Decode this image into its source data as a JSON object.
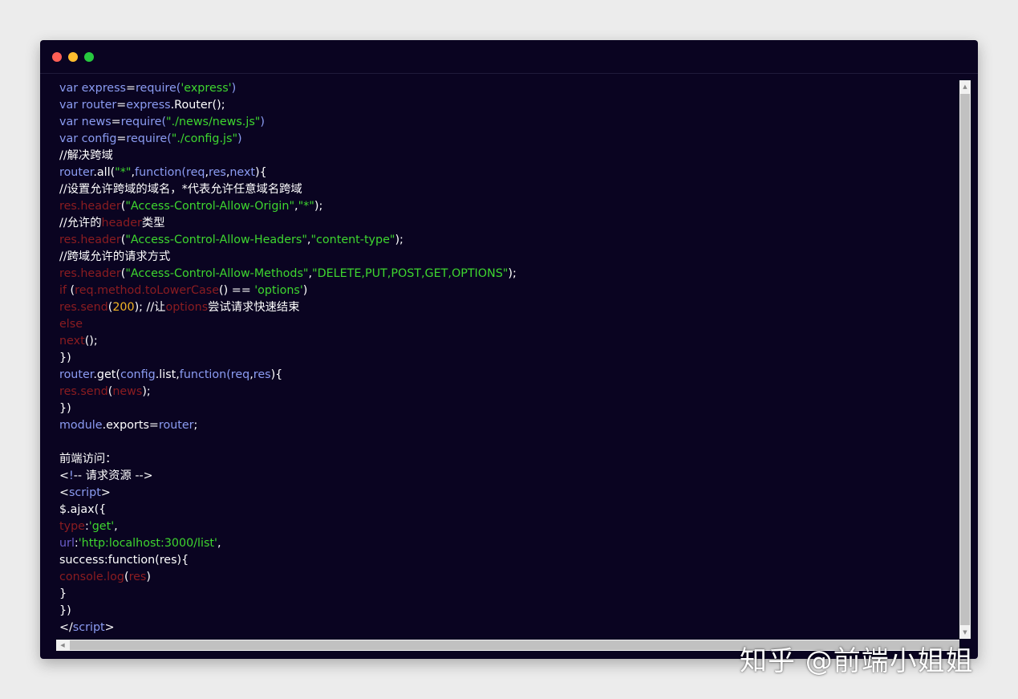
{
  "window": {
    "controls": {
      "close_color": "#ff5f56",
      "minimize_color": "#ffbd2e",
      "maximize_color": "#27c93f"
    },
    "colors": {
      "background": "#0a0421",
      "plain": "#ffffff",
      "keyword": "#8b9cf2",
      "string": "#3ed62f",
      "dark_red": "#8a1c21",
      "number": "#f1b325",
      "purple": "#6a5cc9"
    }
  },
  "code_lines": [
    [
      [
        "b",
        "var express"
      ],
      [
        "w",
        "="
      ],
      [
        "b",
        "require("
      ],
      [
        "g",
        "'express'"
      ],
      [
        "b",
        ")"
      ]
    ],
    [
      [
        "b",
        "var router"
      ],
      [
        "w",
        "="
      ],
      [
        "b",
        "express"
      ],
      [
        "w",
        ".Router();"
      ]
    ],
    [
      [
        "b",
        "var news"
      ],
      [
        "w",
        "="
      ],
      [
        "b",
        "require("
      ],
      [
        "g",
        "\"./news/news.js\""
      ],
      [
        "b",
        ")"
      ]
    ],
    [
      [
        "b",
        "var config"
      ],
      [
        "w",
        "="
      ],
      [
        "b",
        "require("
      ],
      [
        "g",
        "\"./config.js\""
      ],
      [
        "b",
        ")"
      ]
    ],
    [
      [
        "w",
        "//解决跨域"
      ]
    ],
    [
      [
        "b",
        "router"
      ],
      [
        "w",
        ".all("
      ],
      [
        "g",
        "\"*\""
      ],
      [
        "w",
        ","
      ],
      [
        "b",
        "function("
      ],
      [
        "b",
        "req"
      ],
      [
        "w",
        ","
      ],
      [
        "b",
        "res"
      ],
      [
        "w",
        ","
      ],
      [
        "b",
        "next"
      ],
      [
        "w",
        "){"
      ]
    ],
    [
      [
        "w",
        "//设置允许跨域的域名，*代表允许任意域名跨域"
      ]
    ],
    [
      [
        "r",
        "res.header"
      ],
      [
        "w",
        "("
      ],
      [
        "g",
        "\"Access-Control-Allow-Origin\""
      ],
      [
        "w",
        ","
      ],
      [
        "g",
        "\"*\""
      ],
      [
        "w",
        ");"
      ]
    ],
    [
      [
        "w",
        "//允许的"
      ],
      [
        "r",
        "header"
      ],
      [
        "w",
        "类型"
      ]
    ],
    [
      [
        "r",
        "res.header"
      ],
      [
        "w",
        "("
      ],
      [
        "g",
        "\"Access-Control-Allow-Headers\""
      ],
      [
        "w",
        ","
      ],
      [
        "g",
        "\"content-type\""
      ],
      [
        "w",
        ");"
      ]
    ],
    [
      [
        "w",
        "//跨域允许的请求方式"
      ]
    ],
    [
      [
        "r",
        "res.header"
      ],
      [
        "w",
        "("
      ],
      [
        "g",
        "\"Access-Control-Allow-Methods\""
      ],
      [
        "w",
        ","
      ],
      [
        "g",
        "\"DELETE,PUT,POST,GET,OPTIONS\""
      ],
      [
        "w",
        ");"
      ]
    ],
    [
      [
        "r",
        "if"
      ],
      [
        "w",
        " ("
      ],
      [
        "r",
        "req.method.toLowerCase"
      ],
      [
        "w",
        "() == "
      ],
      [
        "g",
        "'options'"
      ],
      [
        "w",
        ")"
      ]
    ],
    [
      [
        "r",
        "res.send"
      ],
      [
        "w",
        "("
      ],
      [
        "y",
        "200"
      ],
      [
        "w",
        "); //让"
      ],
      [
        "r",
        "options"
      ],
      [
        "w",
        "尝试请求快速结束"
      ]
    ],
    [
      [
        "r",
        "else"
      ]
    ],
    [
      [
        "r",
        "next"
      ],
      [
        "w",
        "();"
      ]
    ],
    [
      [
        "w",
        "})"
      ]
    ],
    [
      [
        "b",
        "router"
      ],
      [
        "w",
        ".get("
      ],
      [
        "b",
        "config"
      ],
      [
        "w",
        ".list,"
      ],
      [
        "b",
        "function("
      ],
      [
        "b",
        "req"
      ],
      [
        "w",
        ","
      ],
      [
        "b",
        "res"
      ],
      [
        "w",
        "){"
      ]
    ],
    [
      [
        "r",
        "res.send"
      ],
      [
        "w",
        "("
      ],
      [
        "r",
        "news"
      ],
      [
        "w",
        ");"
      ]
    ],
    [
      [
        "w",
        "})"
      ]
    ],
    [
      [
        "b",
        "module"
      ],
      [
        "w",
        ".exports="
      ],
      [
        "b",
        "router"
      ],
      [
        "w",
        ";"
      ]
    ],
    [
      [
        "w",
        ""
      ]
    ],
    [
      [
        "w",
        "前端访问："
      ]
    ],
    [
      [
        "w",
        "<"
      ],
      [
        "b",
        "!"
      ],
      [
        "w",
        "-- 请求资源 -->"
      ]
    ],
    [
      [
        "w",
        "<"
      ],
      [
        "b",
        "script"
      ],
      [
        "w",
        ">"
      ]
    ],
    [
      [
        "w",
        "$.ajax({"
      ]
    ],
    [
      [
        "r",
        "type"
      ],
      [
        "w",
        ":"
      ],
      [
        "g",
        "'get'"
      ],
      [
        "w",
        ","
      ]
    ],
    [
      [
        "p",
        "url"
      ],
      [
        "w",
        ":"
      ],
      [
        "g",
        "'http:localhost:3000/list'"
      ],
      [
        "w",
        ","
      ]
    ],
    [
      [
        "w",
        "success:function(res){"
      ]
    ],
    [
      [
        "r",
        "console.log"
      ],
      [
        "w",
        "("
      ],
      [
        "r",
        "res"
      ],
      [
        "w",
        ")"
      ]
    ],
    [
      [
        "w",
        "}"
      ]
    ],
    [
      [
        "w",
        "})"
      ]
    ],
    [
      [
        "w",
        "</"
      ],
      [
        "b",
        "script"
      ],
      [
        "w",
        ">"
      ]
    ]
  ],
  "watermark": "知乎 @前端小姐姐"
}
